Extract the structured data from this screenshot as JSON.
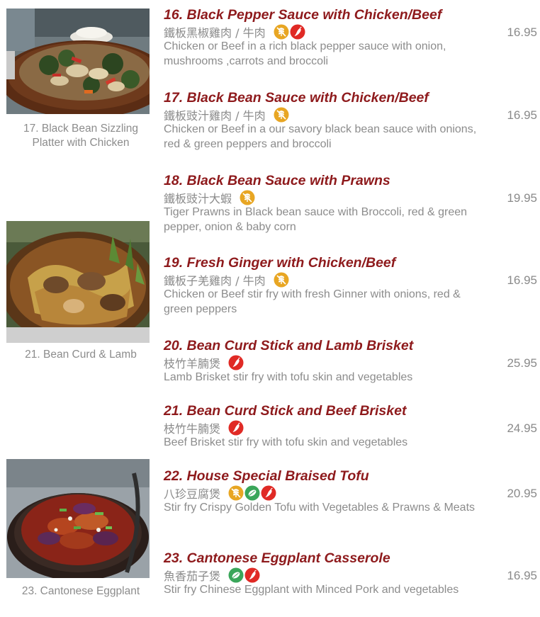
{
  "photos": [
    {
      "caption": "17. Black Bean Sizzling Platter with Chicken"
    },
    {
      "caption": "21. Bean Curd & Lamb"
    },
    {
      "caption": "23. Cantonese Eggplant"
    }
  ],
  "icon_types": {
    "gluten": {
      "name": "gluten-free-icon",
      "color": "#e8a623"
    },
    "veg": {
      "name": "vegetarian-icon",
      "color": "#3aa65a"
    },
    "spicy": {
      "name": "spicy-icon",
      "color": "#e02a25"
    }
  },
  "items": [
    {
      "title": "16. Black Pepper Sauce with Chicken/Beef",
      "chinese": "鐵板黑椒雞肉 / 牛肉",
      "icons": [
        "gluten",
        "spicy"
      ],
      "description": "Chicken or Beef in a rich black pepper sauce with onion, mushrooms ,carrots and broccoli",
      "price": "16.95"
    },
    {
      "title": "17. Black Bean Sauce with Chicken/Beef",
      "chinese": "鐵板豉汁雞肉 / 牛肉",
      "icons": [
        "gluten"
      ],
      "description": "Chicken or Beef in a our savory black bean sauce with onions, red & green peppers and broccoli",
      "price": "16.95"
    },
    {
      "title": "18. Black Bean Sauce with Prawns",
      "chinese": "鐵板豉汁大蝦",
      "icons": [
        "gluten"
      ],
      "description": "Tiger Prawns in Black bean sauce with Broccoli, red & green pepper, onion & baby corn",
      "price": "19.95"
    },
    {
      "title": "19. Fresh Ginger with Chicken/Beef",
      "chinese": "鐵板子羌雞肉 / 牛肉",
      "icons": [
        "gluten"
      ],
      "description": "Chicken or Beef stir fry with fresh Ginner with onions, red & green peppers",
      "price": "16.95"
    },
    {
      "title": "20. Bean Curd Stick and Lamb Brisket",
      "chinese": "枝竹羊腩煲",
      "icons": [
        "spicy"
      ],
      "description": "Lamb Brisket stir fry with tofu skin and vegetables",
      "price": "25.95"
    },
    {
      "title": "21. Bean Curd Stick and Beef Brisket",
      "chinese": "枝竹牛腩煲",
      "icons": [
        "spicy"
      ],
      "description": "Beef Brisket stir fry with tofu skin and vegetables",
      "price": "24.95"
    },
    {
      "title": "22. House Special Braised Tofu",
      "chinese": "八珍豆腐煲",
      "icons": [
        "gluten",
        "veg",
        "spicy"
      ],
      "description": "Stir fry Crispy Golden Tofu with Vegetables & Prawns & Meats",
      "price": "20.95"
    },
    {
      "title": "23. Cantonese Eggplant Casserole",
      "chinese": "魚香茄子煲",
      "icons": [
        "veg",
        "spicy"
      ],
      "description": "Stir fry Chinese Eggplant with Minced Pork and vegetables",
      "price": "16.95"
    }
  ]
}
